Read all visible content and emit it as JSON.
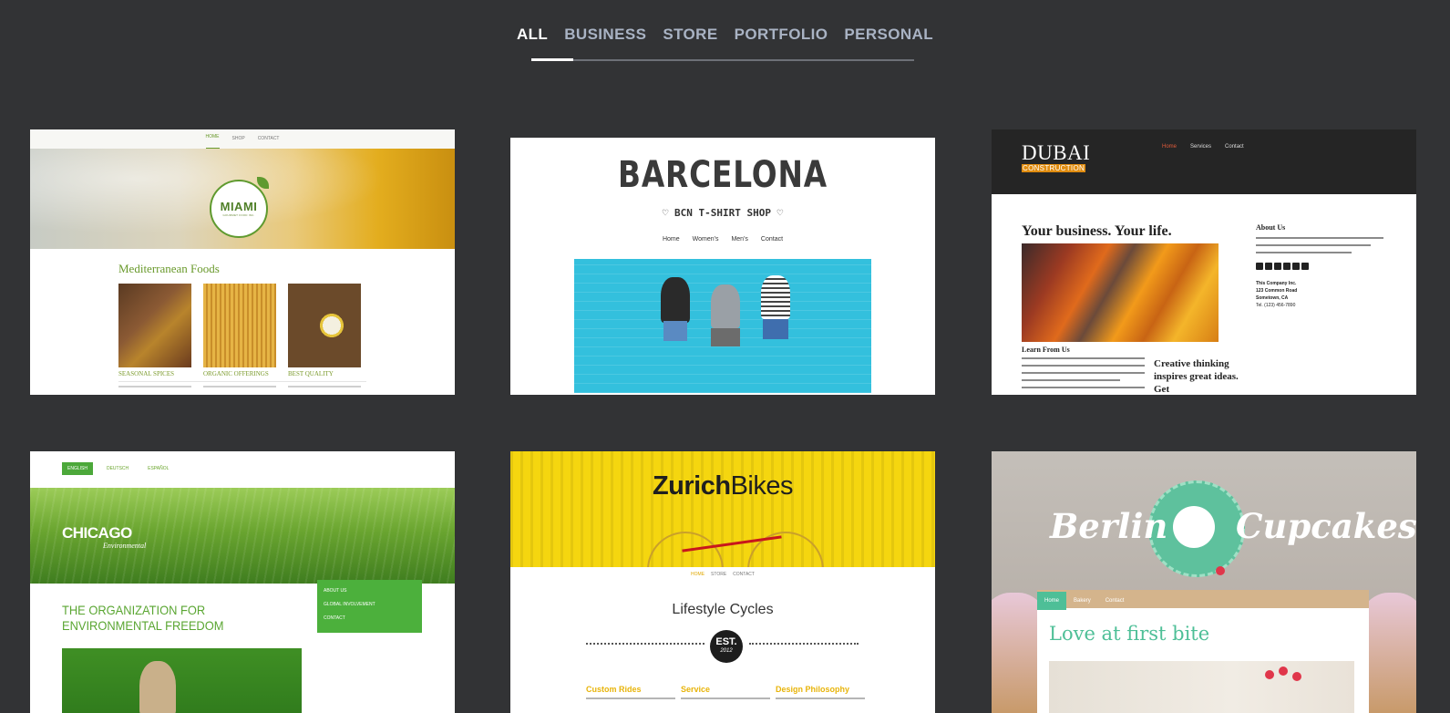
{
  "filters": {
    "tabs": [
      {
        "label": "ALL",
        "active": true
      },
      {
        "label": "BUSINESS",
        "active": false
      },
      {
        "label": "STORE",
        "active": false
      },
      {
        "label": "PORTFOLIO",
        "active": false
      },
      {
        "label": "PERSONAL",
        "active": false
      }
    ]
  },
  "templates": {
    "miami": {
      "nav": [
        "HOME",
        "SHOP",
        "CONTACT"
      ],
      "logo": "MIAMI",
      "logo_sub": "GOURMET FOOD INC.",
      "heading": "Mediterranean Foods",
      "items": [
        "SEASONAL SPICES",
        "ORGANIC OFFERINGS",
        "BEST QUALITY"
      ]
    },
    "barcelona": {
      "title": "BARCELONA",
      "subtitle": "♡ BCN T-SHIRT SHOP ♡",
      "nav": [
        "Home",
        "Women's",
        "Men's",
        "Contact"
      ]
    },
    "dubai": {
      "logo": "DUBAI",
      "logo_sub": "CONSTRUCTION",
      "nav": [
        "Home",
        "Services",
        "Contact"
      ],
      "headline": "Your business. Your life.",
      "learn": "Learn From Us",
      "creative": "Creative thinking inspires great ideas. Get",
      "about": "About Us",
      "address": [
        "This Company Inc.",
        "123 Common Road",
        "Sometown, CA",
        "Tel. (123) 456-7890"
      ]
    },
    "chicago": {
      "languages": [
        "ENGLISH",
        "DEUTSCH",
        "ESPAÑOL"
      ],
      "logo": "CHICAGO",
      "logo_sub": "Environmental",
      "menu": [
        "ABOUT US",
        "GLOBAL INVOLVEMENT",
        "CONTACT"
      ],
      "headline": "THE ORGANIZATION FOR ENVIRONMENTAL FREEDOM"
    },
    "zurich": {
      "logo_bold": "Zurich",
      "logo_light": "Bikes",
      "nav": [
        "HOME",
        "STORE",
        "CONTACT"
      ],
      "headline": "Lifestyle Cycles",
      "badge_top": "EST.",
      "badge_bottom": "2012",
      "columns": [
        "Custom Rides",
        "Service",
        "Design Philosophy"
      ]
    },
    "berlin": {
      "word1": "Berlin",
      "word2": "Cupcakes",
      "nav": [
        "Home",
        "Bakery",
        "Contact"
      ],
      "headline": "Love at first bite"
    }
  },
  "colors": {
    "background": "#323335",
    "tab_inactive": "#a9b3c4",
    "tab_active": "#ffffff"
  }
}
